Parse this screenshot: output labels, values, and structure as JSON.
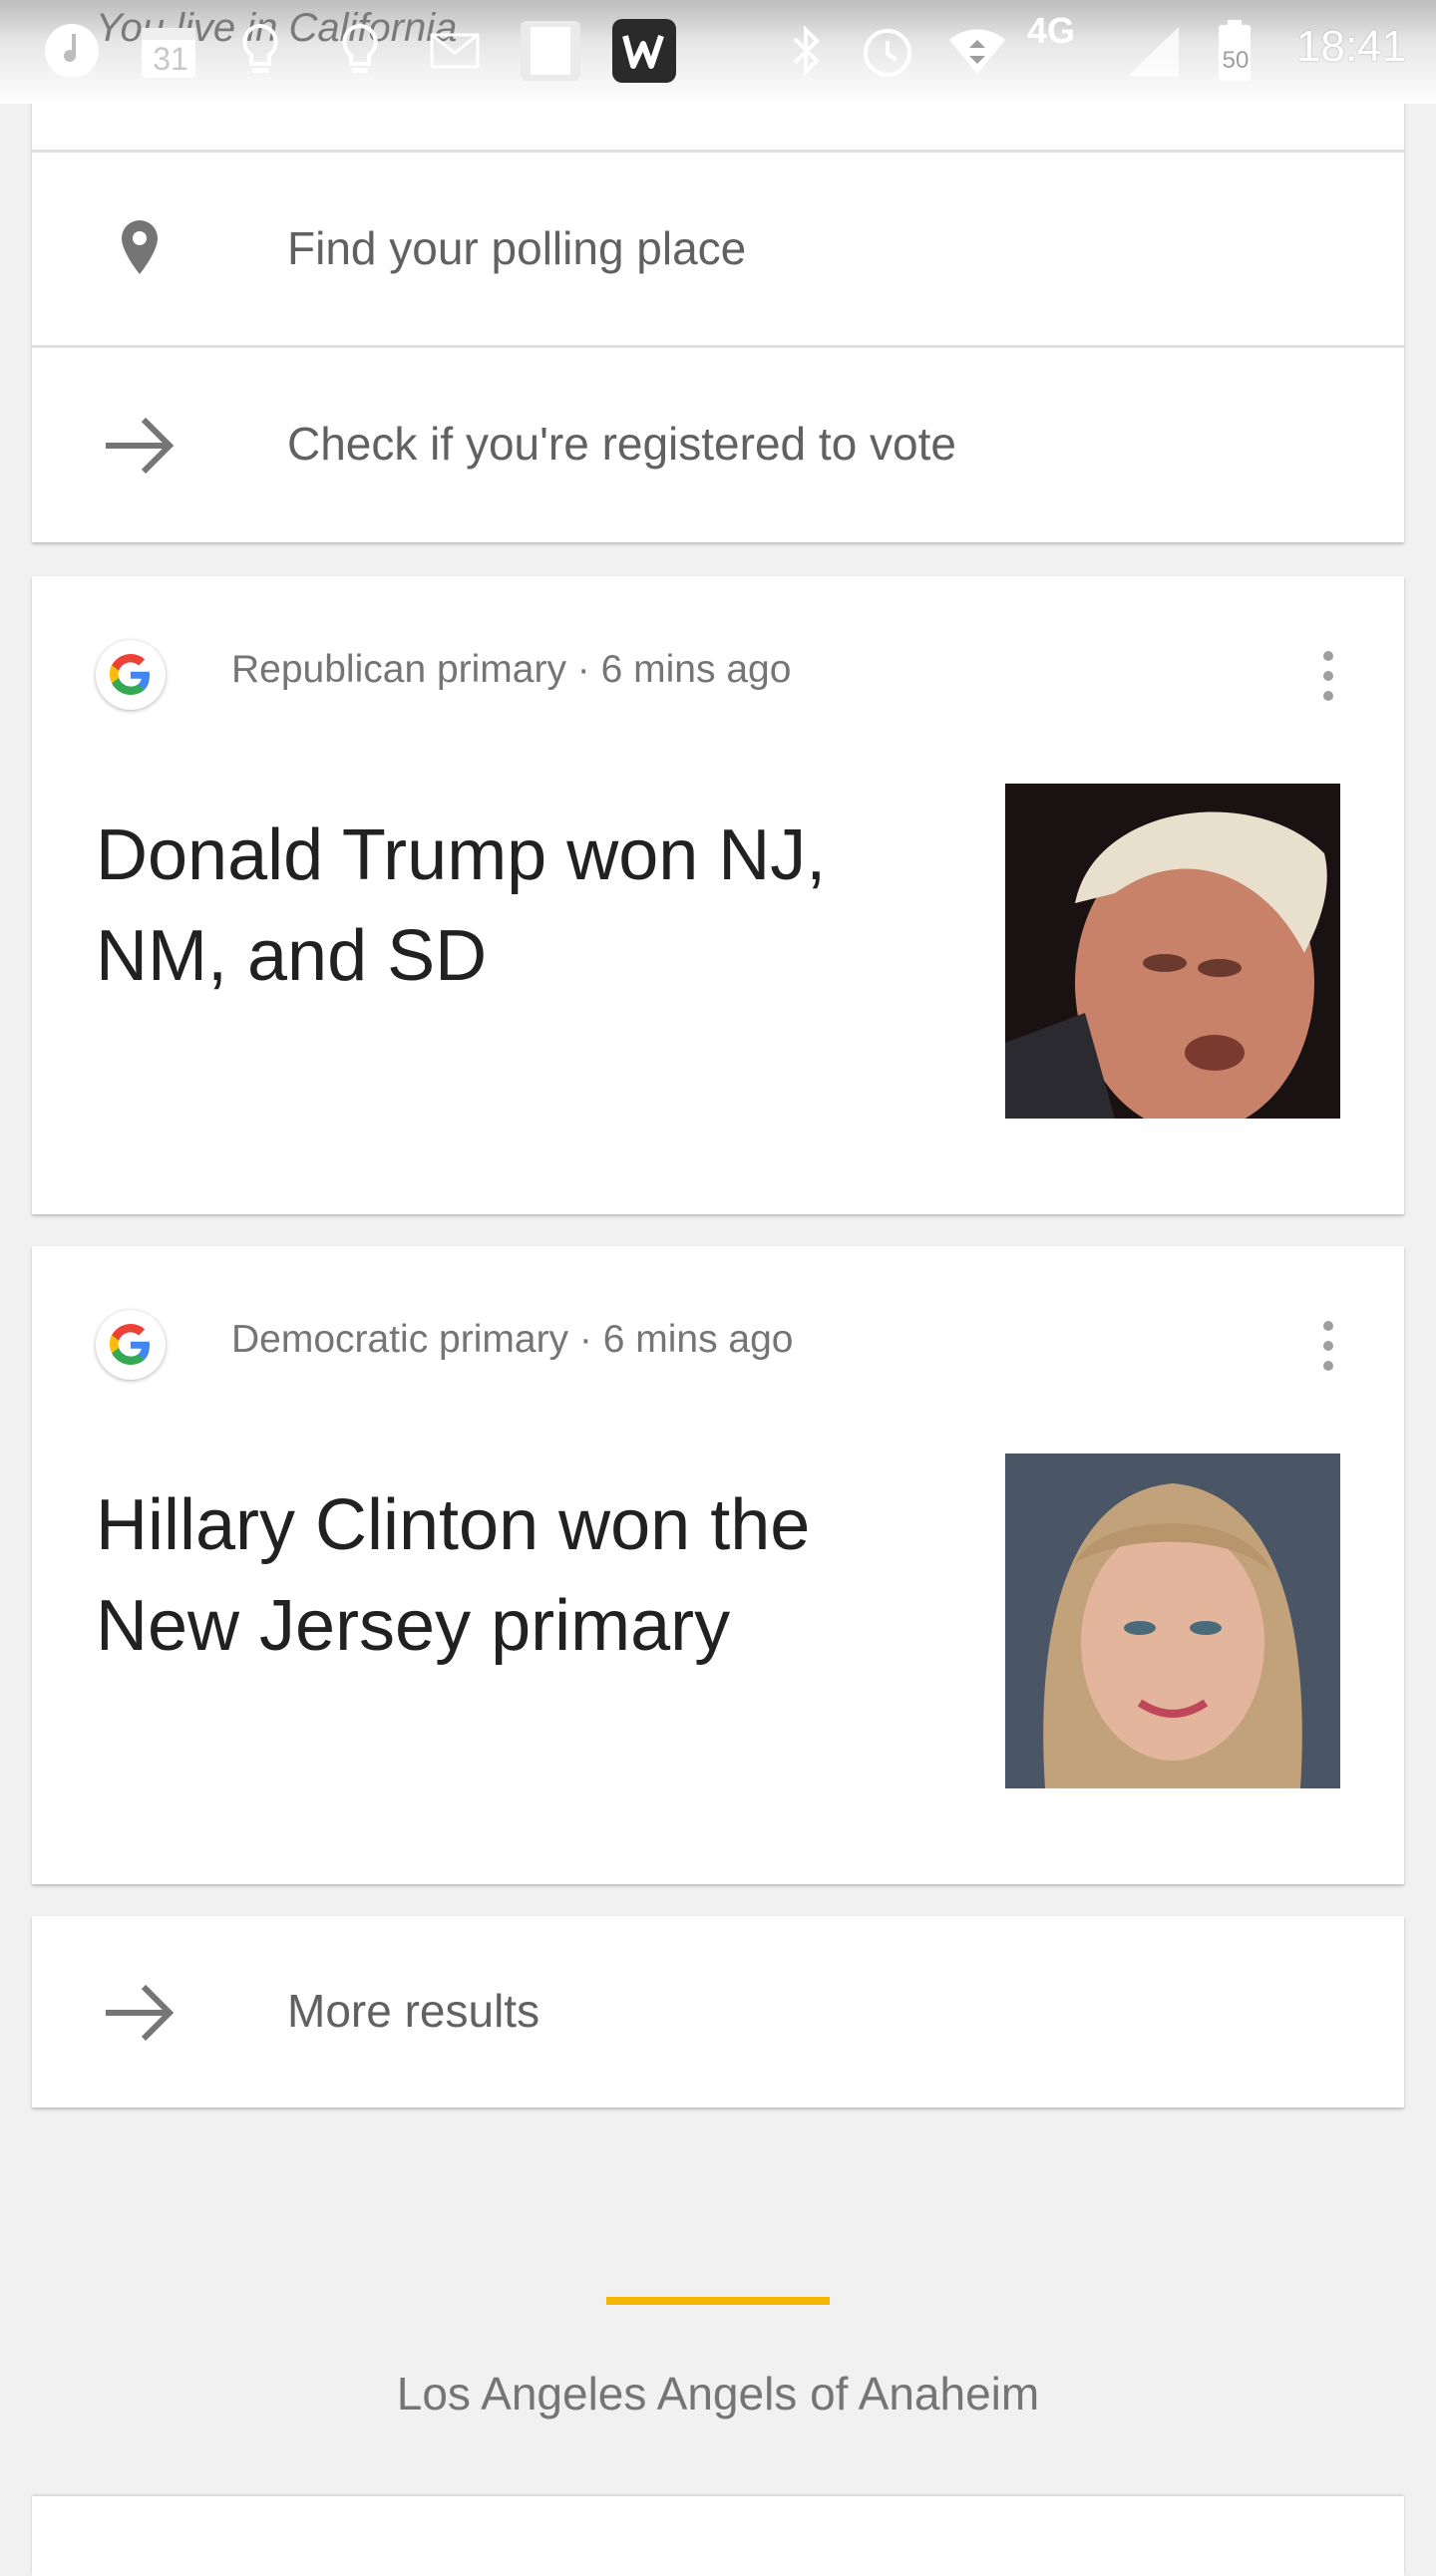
{
  "status_bar": {
    "partial_text": "You live in California",
    "calendar_day": "31",
    "network": "4G",
    "battery": "50",
    "time": "18:41",
    "icons": [
      "music-note-icon",
      "calendar-icon",
      "lightbulb-icon",
      "lightbulb-icon",
      "mail-icon",
      "bible-app-icon",
      "wish-app-icon",
      "bluetooth-icon",
      "alarm-icon",
      "wifi-data-icon",
      "signal-icon",
      "battery-icon"
    ]
  },
  "voting_card": {
    "polling_place": "Find your polling place",
    "registration": "Check if you're registered to vote"
  },
  "news": [
    {
      "meta": "Republican primary · 6 mins ago",
      "headline": "Donald Trump won NJ, NM, and SD",
      "image_label": "Donald Trump photo"
    },
    {
      "meta": "Democratic primary · 6 mins ago",
      "headline": "Hillary Clinton won the New Jersey primary",
      "image_label": "Hillary Clinton photo"
    }
  ],
  "more_results": "More results",
  "next_section": {
    "title": "Los Angeles Angels of Anaheim",
    "accent_color": "#f4b400"
  },
  "colors": {
    "background": "#f1f1f1",
    "card": "#ffffff",
    "text_primary": "#212121",
    "text_secondary": "#757575"
  }
}
